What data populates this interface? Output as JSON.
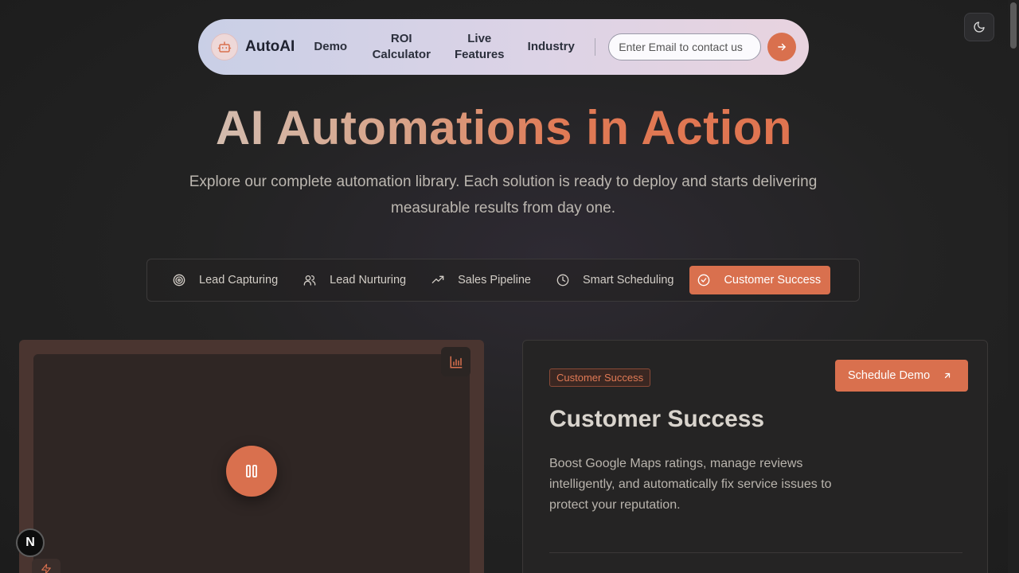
{
  "nav": {
    "brand": "AutoAI",
    "links": [
      {
        "label": "Demo"
      },
      {
        "label": "ROI Calculator"
      },
      {
        "label": "Live Features"
      },
      {
        "label": "Industry"
      }
    ],
    "email_placeholder": "Enter Email to contact us"
  },
  "hero": {
    "title": "AI Automations in Action",
    "subtitle": "Explore our complete automation library. Each solution is ready to deploy and starts delivering measurable results from day one."
  },
  "tabs": [
    {
      "label": "Lead Capturing",
      "icon": "target-icon",
      "active": false
    },
    {
      "label": "Lead Nurturing",
      "icon": "users-icon",
      "active": false
    },
    {
      "label": "Sales Pipeline",
      "icon": "trending-up-icon",
      "active": false
    },
    {
      "label": "Smart Scheduling",
      "icon": "clock-icon",
      "active": false
    },
    {
      "label": "Customer Success",
      "icon": "check-circle-icon",
      "active": true
    }
  ],
  "info": {
    "tag": "Customer Success",
    "cta": "Schedule Demo",
    "title": "Customer Success",
    "description": "Boost Google Maps ratings, manage reviews intelligently, and automatically fix service issues to protect your reputation."
  },
  "next_badge": "N",
  "colors": {
    "accent": "#d9704e",
    "background": "#232323",
    "nav_bg_start": "#c9cfe6",
    "nav_bg_end": "#e8d3df"
  }
}
